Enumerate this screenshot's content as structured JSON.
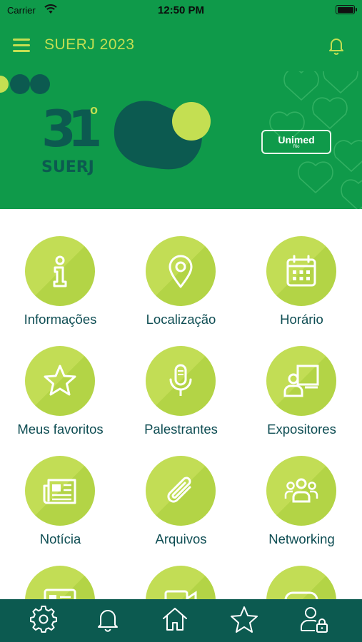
{
  "status_bar": {
    "carrier": "Carrier",
    "time": "12:50 PM"
  },
  "header": {
    "title": "SUERJ 2023",
    "menu_icon": "hamburger-icon",
    "notification_icon": "bell-icon"
  },
  "banner": {
    "edition": "31",
    "edition_suffix": "o",
    "event_name": "SUERJ",
    "sponsor": "Unimed",
    "sponsor_sub": "Rio"
  },
  "colors": {
    "primary_green": "#0f9a4a",
    "accent_lime": "#c4df52",
    "dark_teal": "#0c5a50",
    "label_text": "#0e4d53"
  },
  "menu": {
    "items": [
      {
        "label": "Informações",
        "icon": "info-icon"
      },
      {
        "label": "Localização",
        "icon": "location-pin-icon"
      },
      {
        "label": "Horário",
        "icon": "calendar-icon"
      },
      {
        "label": "Meus favoritos",
        "icon": "star-icon"
      },
      {
        "label": "Palestrantes",
        "icon": "microphone-icon"
      },
      {
        "label": "Expositores",
        "icon": "presenter-icon"
      },
      {
        "label": "Notícia",
        "icon": "newspaper-icon"
      },
      {
        "label": "Arquivos",
        "icon": "paperclip-icon"
      },
      {
        "label": "Networking",
        "icon": "group-icon"
      }
    ]
  },
  "bottom_nav": {
    "items": [
      {
        "icon": "gear-icon"
      },
      {
        "icon": "bell-icon"
      },
      {
        "icon": "home-icon"
      },
      {
        "icon": "star-icon"
      },
      {
        "icon": "user-lock-icon"
      }
    ]
  }
}
